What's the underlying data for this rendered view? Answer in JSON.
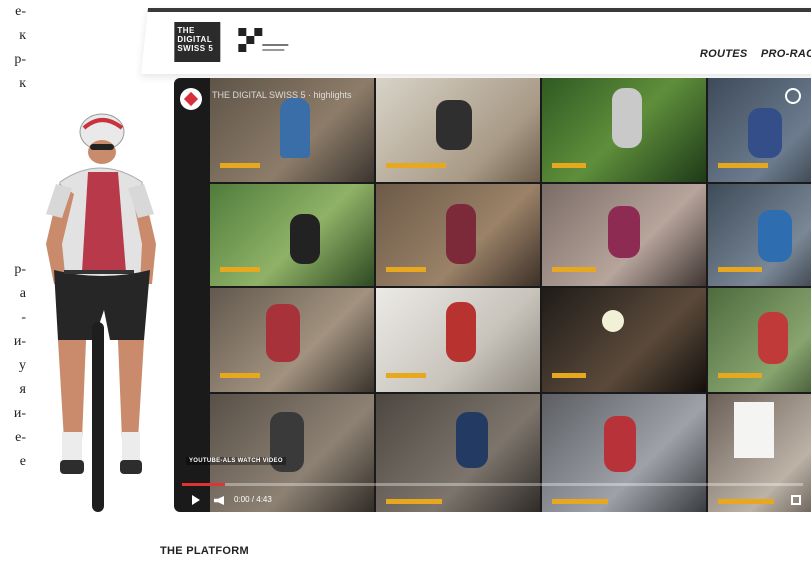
{
  "left_column_fragments": [
    "e-",
    "к",
    "р-",
    "к",
    "",
    "",
    "",
    "",
    "",
    "р-",
    "а",
    "-",
    "и-",
    "у",
    "я",
    "и-",
    "е-",
    "е"
  ],
  "header": {
    "logo_lines": [
      "THE",
      "DIGITAL",
      "SWISS 5"
    ],
    "nav": [
      "ROUTES",
      "PRO-RAC"
    ]
  },
  "video": {
    "title": "THE DIGITAL SWISS 5 · highlights",
    "watch_label": "YOUTUBE-ALS WATCH VIDEO",
    "time": "0:00 / 4:43",
    "progress": 0.07,
    "accent": "#e7a81f"
  },
  "section_title": "THE PLATFORM"
}
